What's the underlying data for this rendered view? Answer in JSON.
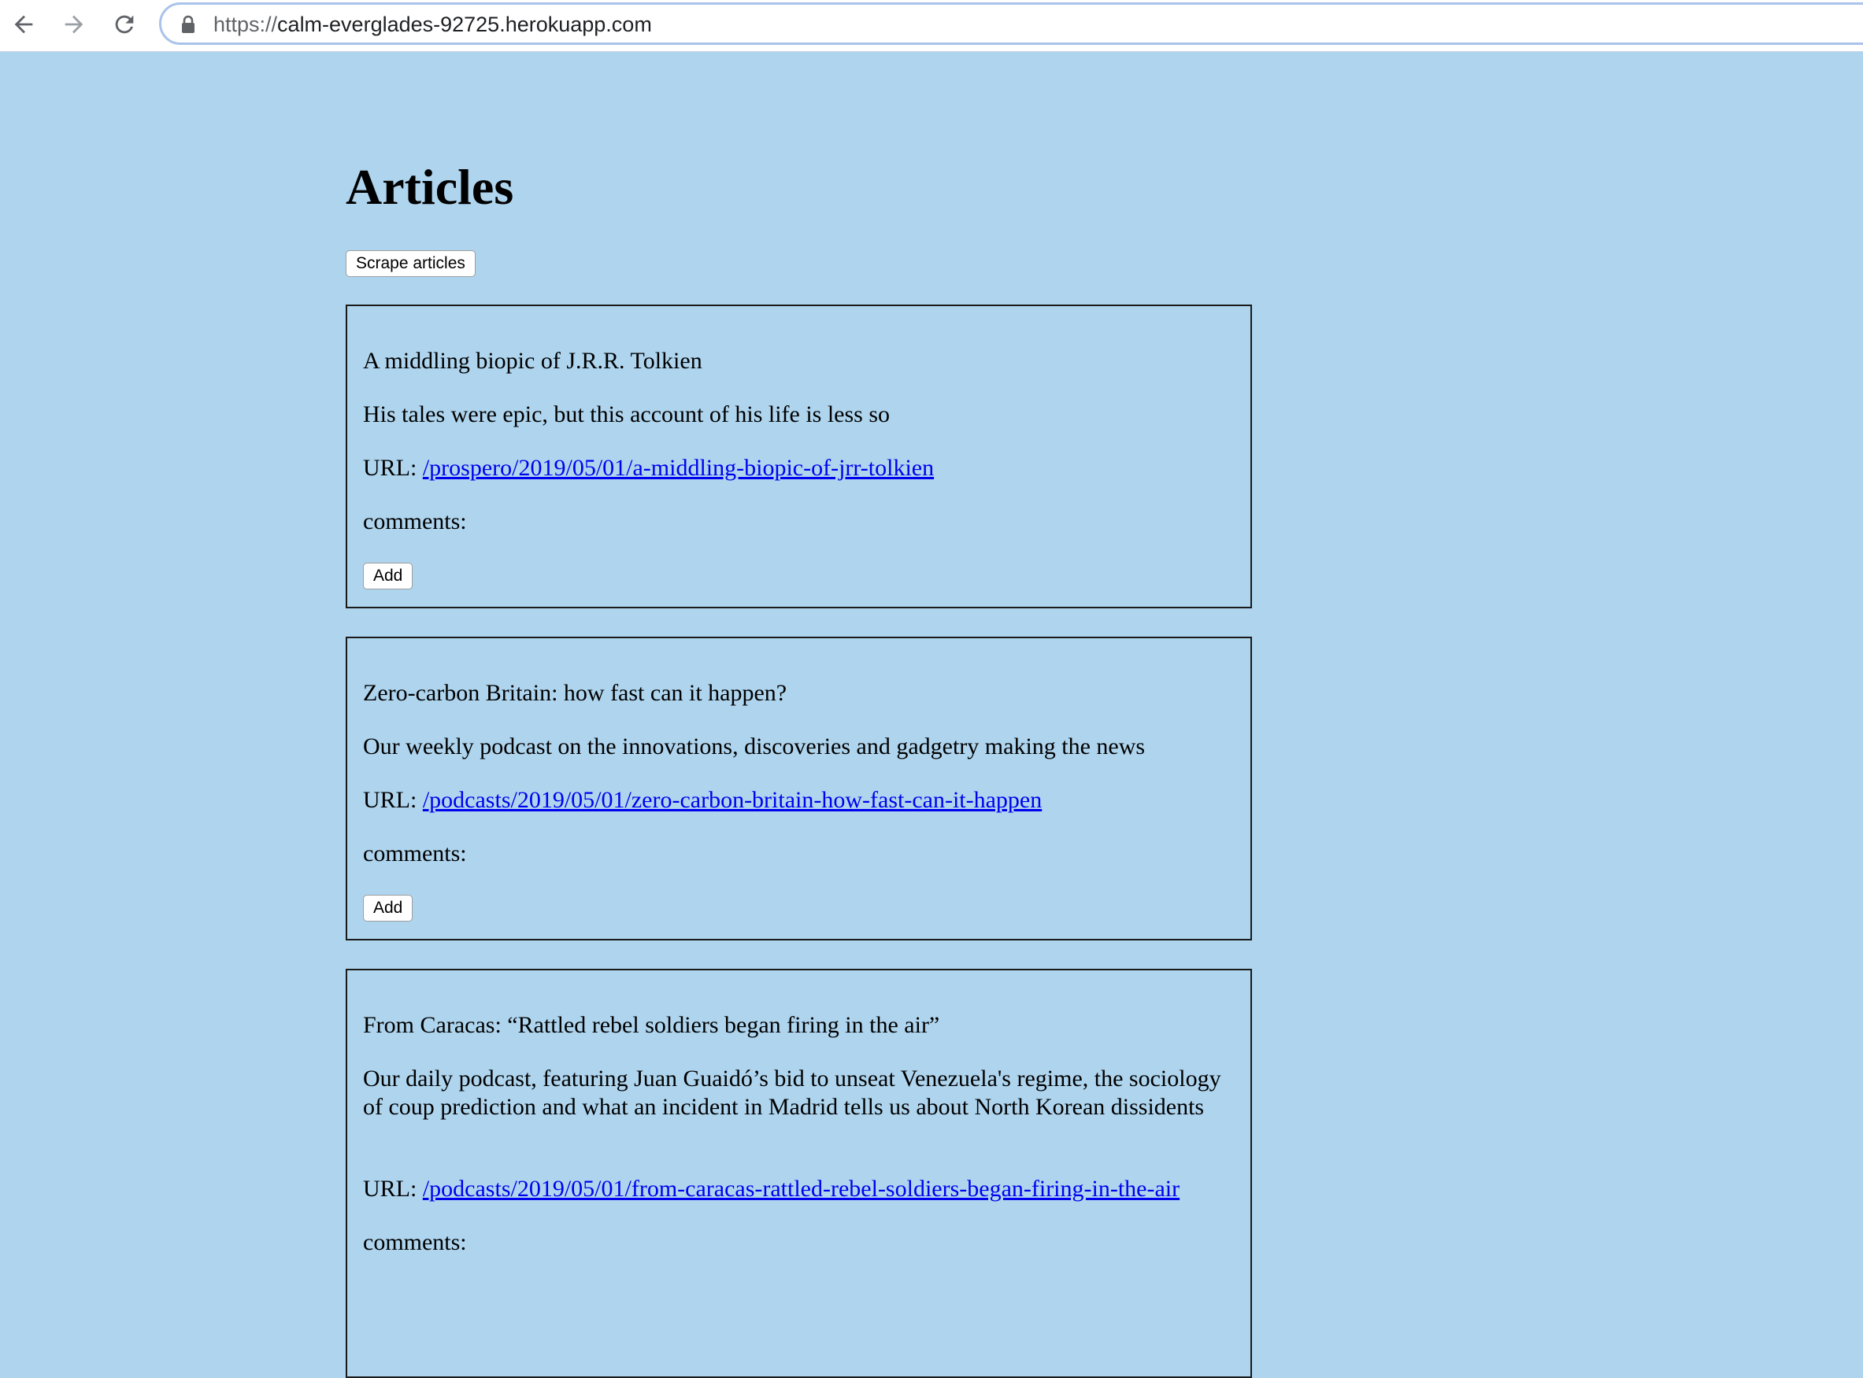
{
  "browser": {
    "url_scheme": "https://",
    "url_host": "calm-everglades-92725.herokuapp.com",
    "icons": [
      "back-arrow-icon",
      "forward-arrow-icon",
      "reload-icon",
      "lock-icon"
    ]
  },
  "page": {
    "title": "Articles",
    "scrape_button": "Scrape articles"
  },
  "articles": [
    {
      "headline": "A middling biopic of J.R.R. Tolkien",
      "summary": "His tales were epic, but this account of his life is less so",
      "url_label": "URL:",
      "url": "/prospero/2019/05/01/a-middling-biopic-of-jrr-tolkien",
      "comments_label": "comments:",
      "add_button": "Add"
    },
    {
      "headline": "Zero-carbon Britain: how fast can it happen?",
      "summary": "Our weekly podcast on the innovations, discoveries and gadgetry making the news",
      "url_label": "URL:",
      "url": "/podcasts/2019/05/01/zero-carbon-britain-how-fast-can-it-happen",
      "comments_label": "comments:",
      "add_button": "Add"
    },
    {
      "headline": "From Caracas: “Rattled rebel soldiers began firing in the air”",
      "summary": "Our daily podcast, featuring Juan Guaidó’s bid to unseat Venezuela's regime, the sociology of coup prediction and what an incident in Madrid tells us about North Korean dissidents",
      "url_label": "URL:",
      "url": "/podcasts/2019/05/01/from-caracas-rattled-rebel-soldiers-began-firing-in-the-air",
      "comments_label": "comments:"
    }
  ],
  "colors": {
    "page_background": "#aed4ee",
    "link": "#0000ee",
    "card_border": "#1a1a1a"
  }
}
